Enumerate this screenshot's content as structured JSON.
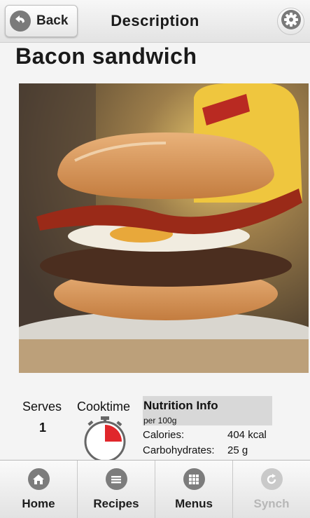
{
  "header": {
    "back_label": "Back",
    "title": "Description",
    "settings_icon": "gear-icon",
    "back_icon": "back-arrow-icon"
  },
  "recipe": {
    "title": "Bacon sandwich",
    "image_subject": "bacon sandwich photo"
  },
  "stats": {
    "serves_label": "Serves",
    "serves_value": "1",
    "cooktime_label": "Cooktime",
    "cooktime_icon": "stopwatch-icon",
    "cooktime_fill": 0.25
  },
  "nutrition": {
    "title": "Nutrition Info",
    "subtitle": "per 100g",
    "rows": [
      {
        "label": "Calories:",
        "value": "404 kcal"
      },
      {
        "label": "Carbohydrates:",
        "value": "25 g"
      }
    ]
  },
  "nav": {
    "items": [
      {
        "label": "Home",
        "icon": "home-icon",
        "enabled": true
      },
      {
        "label": "Recipes",
        "icon": "list-icon",
        "enabled": true
      },
      {
        "label": "Menus",
        "icon": "grid-icon",
        "enabled": true
      },
      {
        "label": "Synch",
        "icon": "sync-icon",
        "enabled": false
      }
    ]
  },
  "colors": {
    "accent_red": "#e0262b",
    "nav_icon": "#7c7c7c",
    "disabled": "#c9c9c9"
  }
}
